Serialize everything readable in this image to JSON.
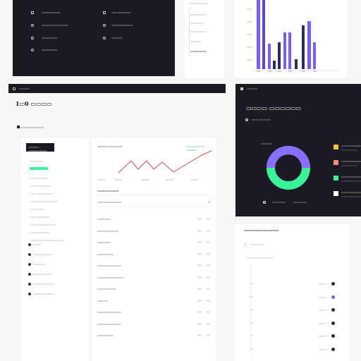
{
  "top_left_panel": {
    "rows": [
      {
        "icon": "square-icon",
        "label": "▭▭▭▭▭▭▭",
        "icon2": "square-icon",
        "label2": "▭▭ ▭▭▭▭▭"
      },
      {
        "icon": "circle-icon",
        "label": "▭▭▭▭▭▭▭▭▭▭",
        "icon2": "circle-icon",
        "label2": "▭▭▭▭▭▭▭▭"
      },
      {
        "icon": "circle-icon",
        "label": "▭▭▭▭▭▭",
        "icon2": "circle-icon",
        "label2": "▭▭▭▭"
      },
      {
        "icon": "circle-icon",
        "label": "▭▭▭▭▭▭",
        "icon2": "",
        "label2": ""
      }
    ]
  },
  "top_middle_list": {
    "title": "▭▭▭▭▭▭▭",
    "items": [
      "▭▭▭▭▭▭",
      "▭▭▭▭▭",
      "▭▭▭▭▭▭",
      "▭▭▭▭",
      "▭▭▭▭▭▭"
    ]
  },
  "top_right_chart": {
    "colors": {
      "purple": "#7a5cff",
      "navy": "#2a2e5c"
    }
  },
  "mid_left_window": {
    "titlebar": "▭▭▭▭",
    "heading": "1▭0 ▭▭▭▭",
    "subtext": "▭▭▭▭▭▭▭▭▭",
    "filter_label": "▭▭▭▭▭▭",
    "sidebar": {
      "header": "▭▭▭▭ ▭▭▭▭▭▭▭",
      "active_item": "▭▭▭▭▭",
      "items": [
        "▭▭▭▭▭▭",
        "▭▭▭▭▭▭▭",
        "▭▭▭▭▭▭▭▭",
        "▭▭▭▭▭▭▭▭▭▭",
        "▭▭▭▭▭",
        "▭▭▭▭▭▭▭",
        "▭▭▭▭▭▭▭▭▭",
        "▭▭▭▭▭▭▭",
        "▭▭▭▭▭▭▭▭▭▭▭▭"
      ],
      "footer_items": [
        "▭▭▭",
        "▭▭▭▭▭▭▭",
        "▭▭▭▭▭",
        "▭▭▭▭▭▭▭",
        "▭▭▭▭▭▭▭▭",
        "▭▭▭▭▭▭▭▭"
      ]
    },
    "chart": {
      "title": "▭▭▭▭ ▭▭▭▭▭",
      "legend": "▭▭▭▭▭▭▭ ▭▭▭▭",
      "x_labels": [
        "▭▭▭",
        "▭▭▭",
        "▭▭▭",
        "▭▭▭",
        "▭▭▭"
      ]
    },
    "table": {
      "title": "▭▭▭▭▭▭▭▭",
      "select_label": "▭▭▭▭▭▭▭▭▭",
      "rows": [
        "▭▭▭▭▭",
        "▭▭▭▭▭▭▭▭",
        "▭▭▭▭▭",
        "▭▭▭▭▭▭",
        "▭▭▭▭▭▭▭▭▭",
        "▭▭▭▭▭▭▭▭▭▭",
        "▭▭▭▭▭▭▭",
        "▭▭▭▭",
        "▭▭▭▭▭▭▭▭▭",
        "▭▭▭▭▭▭▭▭▭",
        "▭▭▭▭▭▭"
      ]
    }
  },
  "mid_right_window": {
    "titlebar": "▭▭▭▭",
    "heading": "▭▭▭▭ ▭▭▭▭▭▭",
    "subtext": "▭▭▭▭▭▭▭",
    "donut_label": "▭▭▭▭",
    "legend": [
      {
        "color": "#f2c531",
        "label": "▭▭▭▭▭▭▭▭",
        "sub": "▭▭▭▭▭▭"
      },
      {
        "color": "#ff8a7a",
        "label": "▭▭▭▭▭▭▭▭",
        "sub": "▭▭▭▭▭▭"
      },
      {
        "color": "#39f29a",
        "label": "▭▭▭▭▭▭▭▭▭▭",
        "sub": "▭▭▭▭▭▭▭▭"
      },
      {
        "color": "#ffffff",
        "label": "▭▭▭▭▭▭▭▭▭",
        "sub": "▭▭▭▭▭▭▭▭"
      }
    ],
    "footer_left": "▭▭▭▭▭",
    "footer_right": "▭▭▭▭▭"
  },
  "bottom_right_panel": {
    "title": "▭▭▭▭▭▭▭▭▭▭▭▭▭",
    "subtitle": "▭▭▭▭▭",
    "row_label": "▭▭▭▭▭▭▭▭▭▭",
    "items": [
      {
        "label": "▭▭▭",
        "color": "#2a2a33"
      },
      {
        "label": "▭▭▭",
        "color": "#7a5cff"
      },
      {
        "label": "▭▭▭",
        "color": "#2a2a33"
      },
      {
        "label": "▭▭▭",
        "color": "#2a2a33"
      },
      {
        "label": "▭▭▭",
        "color": "#2a2a33"
      },
      {
        "label": "▭▭▭",
        "color": "#2a2a33"
      }
    ]
  },
  "colors": {
    "accent_green": "#39f29a",
    "accent_purple": "#7a5cff",
    "line_red": "#d94a4a",
    "dark_bg": "#1b1a22"
  }
}
